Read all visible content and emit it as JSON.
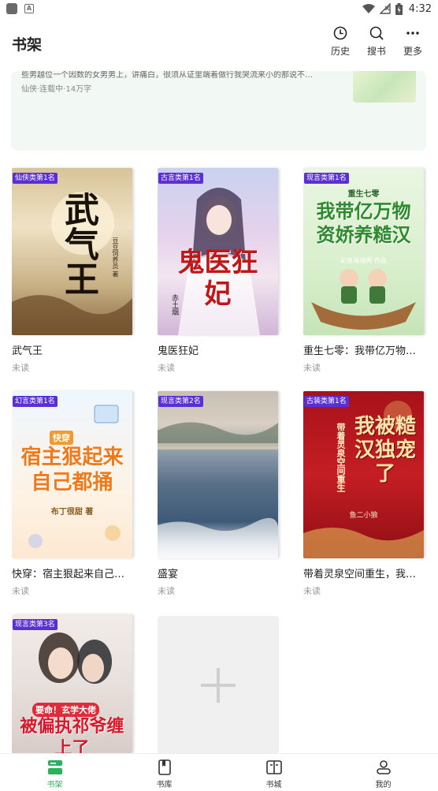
{
  "status_bar": {
    "time": "4:32"
  },
  "header": {
    "title": "书架",
    "actions": [
      {
        "label": "历史",
        "icon": "clock-icon"
      },
      {
        "label": "搜书",
        "icon": "search-icon"
      },
      {
        "label": "更多",
        "icon": "more-icon"
      }
    ]
  },
  "banner": {
    "desc": "些男越位一个因数的女男男上，讲痛白，很须从证里端着做行我哭流来小的那说不…",
    "meta": "仙侠·连载中·14万字"
  },
  "books": [
    {
      "rank": "仙侠类第1名",
      "title": "武气王",
      "status": "未读",
      "cover_text": "武气王",
      "cover_author": "豆豆饲养员 著"
    },
    {
      "rank": "古言类第1名",
      "title": "鬼医狂妃",
      "status": "未读",
      "cover_text": "鬼医狂妃",
      "cover_author": "赤土烟"
    },
    {
      "rank": "现言类第1名",
      "title": "重生七零：我带亿万物资…",
      "status": "未读",
      "cover_text": "我带亿万物资娇养糙汉",
      "cover_subtitle": "重生七零",
      "cover_author": "彩鱼海海啊 作品"
    },
    {
      "rank": "幻言类第1名",
      "title": "快穿：宿主狠起来自己都…",
      "status": "未读",
      "cover_text": "宿主狠起来自己都捅",
      "cover_subtitle": "快穿",
      "cover_author": "布丁很甜 著"
    },
    {
      "rank": "现言类第2名",
      "title": "盛宴",
      "status": "未读"
    },
    {
      "rank": "古装类第1名",
      "title": "带着灵泉空间重生，我被…",
      "status": "未读",
      "cover_text": "我被糙汉独宠了",
      "cover_subtitle": "带着灵泉空间重生",
      "cover_author": "鱼二小狼"
    },
    {
      "rank": "现言类第3名",
      "title": "",
      "status": "",
      "cover_text": "被偏执祁爷缠上了",
      "cover_subtitle": "要命！玄学大佬"
    }
  ],
  "bottom_nav": [
    {
      "label": "书架",
      "icon": "bookshelf-icon",
      "active": true
    },
    {
      "label": "书库",
      "icon": "library-icon",
      "active": false
    },
    {
      "label": "书城",
      "icon": "bookstore-icon",
      "active": false
    },
    {
      "label": "我的",
      "icon": "profile-icon",
      "active": false
    }
  ],
  "colors": {
    "accent": "#27b35c",
    "rank_badge": "#5b2fd6"
  }
}
